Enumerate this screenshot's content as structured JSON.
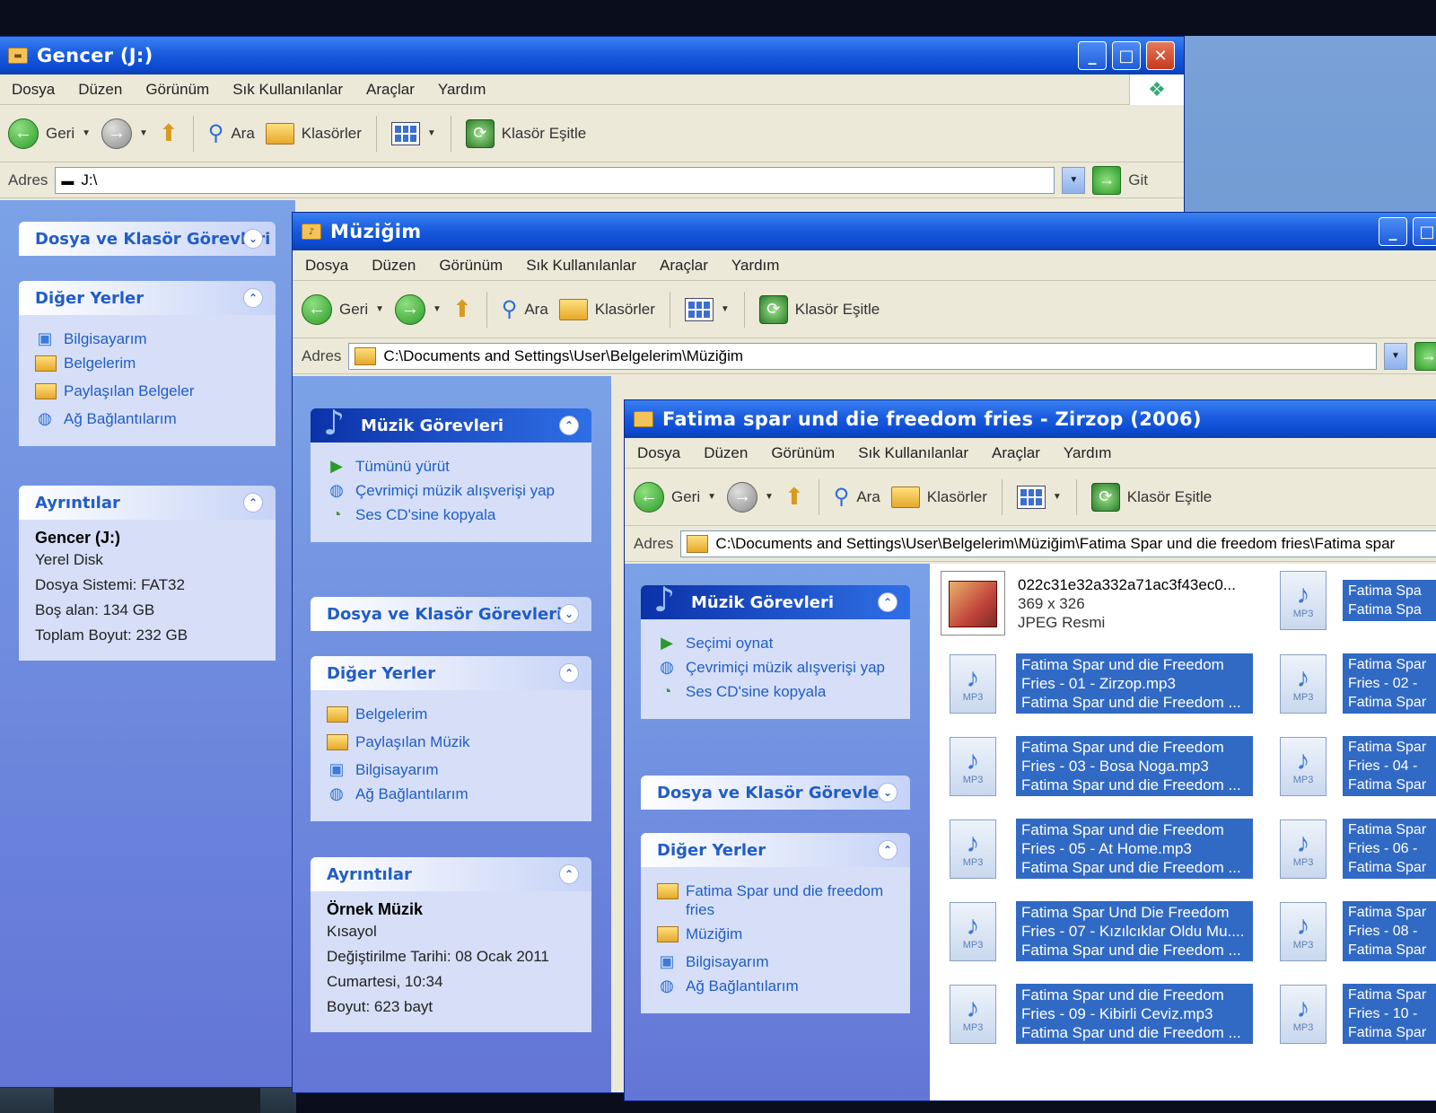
{
  "menu": [
    "Dosya",
    "Düzen",
    "Görünüm",
    "Sık Kullanılanlar",
    "Araçlar",
    "Yardım"
  ],
  "toolbar": {
    "back": "Geri",
    "search": "Ara",
    "folders": "Klasörler",
    "sync": "Klasör Eşitle"
  },
  "address_label": "Adres",
  "go_label": "Git",
  "win1": {
    "title": "Gencer (J:)",
    "address": "J:\\",
    "panels": {
      "file_tasks": "Dosya ve Klasör Görevleri",
      "other_places": {
        "title": "Diğer Yerler",
        "items": [
          "Bilgisayarım",
          "Belgelerim",
          "Paylaşılan Belgeler",
          "Ağ Bağlantılarım"
        ]
      },
      "details": {
        "title": "Ayrıntılar",
        "name": "Gencer (J:)",
        "type": "Yerel Disk",
        "fs": "Dosya Sistemi: FAT32",
        "free": "Boş alan: 134 GB",
        "total": "Toplam Boyut: 232 GB"
      }
    }
  },
  "win2": {
    "title": "Müziğim",
    "address": "C:\\Documents and Settings\\User\\Belgelerim\\Müziğim",
    "panels": {
      "music_tasks": {
        "title": "Müzik Görevleri",
        "items": [
          "Tümünü yürüt",
          "Çevrimiçi müzik alışverişi yap",
          "Ses CD'sine kopyala"
        ]
      },
      "file_tasks": "Dosya ve Klasör Görevleri",
      "other_places": {
        "title": "Diğer Yerler",
        "items": [
          "Belgelerim",
          "Paylaşılan Müzik",
          "Bilgisayarım",
          "Ağ Bağlantılarım"
        ]
      },
      "details": {
        "title": "Ayrıntılar",
        "name": "Örnek Müzik",
        "type": "Kısayol",
        "modified1": "Değiştirilme Tarihi: 08 Ocak 2011",
        "modified2": "Cumartesi, 10:34",
        "size": "Boyut: 623 bayt"
      }
    }
  },
  "win3": {
    "title": "Fatima spar und die freedom fries - Zirzop (2006)",
    "address": "C:\\Documents and Settings\\User\\Belgelerim\\Müziğim\\Fatima Spar und die freedom fries\\Fatima spar",
    "panels": {
      "music_tasks": {
        "title": "Müzik Görevleri",
        "items": [
          "Seçimi oynat",
          "Çevrimiçi müzik alışverişi yap",
          "Ses CD'sine kopyala"
        ]
      },
      "file_tasks": "Dosya ve Klasör Görevleri",
      "other_places": {
        "title": "Diğer Yerler",
        "items": [
          "Fatima Spar und die freedom fries",
          "Müziğim",
          "Bilgisayarım",
          "Ağ Bağlantılarım"
        ]
      }
    },
    "jpg": {
      "name": "022c31e32a332a71ac3f43ec0...",
      "dims": "369 x 326",
      "type": "JPEG Resmi"
    },
    "files": [
      {
        "l1": "Fatima Spar und die Freedom",
        "l2": "Fries - 01 - Zirzop.mp3",
        "l3": "Fatima Spar und die Freedom ..."
      },
      {
        "l1": "Fatima Spar und die Freedom",
        "l2": "Fries - 03 - Bosa Noga.mp3",
        "l3": "Fatima Spar und die Freedom ..."
      },
      {
        "l1": "Fatima Spar und die Freedom",
        "l2": "Fries - 05 - At Home.mp3",
        "l3": "Fatima Spar und die Freedom ..."
      },
      {
        "l1": "Fatima Spar Und Die Freedom",
        "l2": "Fries - 07 - Kızılcıklar Oldu Mu....",
        "l3": "Fatima Spar und die Freedom ..."
      },
      {
        "l1": "Fatima Spar und die Freedom",
        "l2": "Fries - 09 - Kibirli Ceviz.mp3",
        "l3": "Fatima Spar und die Freedom ..."
      }
    ],
    "files_right": [
      {
        "l1": "Fatima Spa",
        "l2": "Fatima Spa"
      },
      {
        "l1": "Fatima Spar",
        "l2": "Fries - 02 -",
        "l3": "Fatima Spar"
      },
      {
        "l1": "Fatima Spar",
        "l2": "Fries - 04 -",
        "l3": "Fatima Spar"
      },
      {
        "l1": "Fatima Spar",
        "l2": "Fries - 06 -",
        "l3": "Fatima Spar"
      },
      {
        "l1": "Fatima Spar",
        "l2": "Fries - 08 -",
        "l3": "Fatima Spar"
      },
      {
        "l1": "Fatima Spar",
        "l2": "Fries - 10 -",
        "l3": "Fatima Spar"
      }
    ]
  }
}
